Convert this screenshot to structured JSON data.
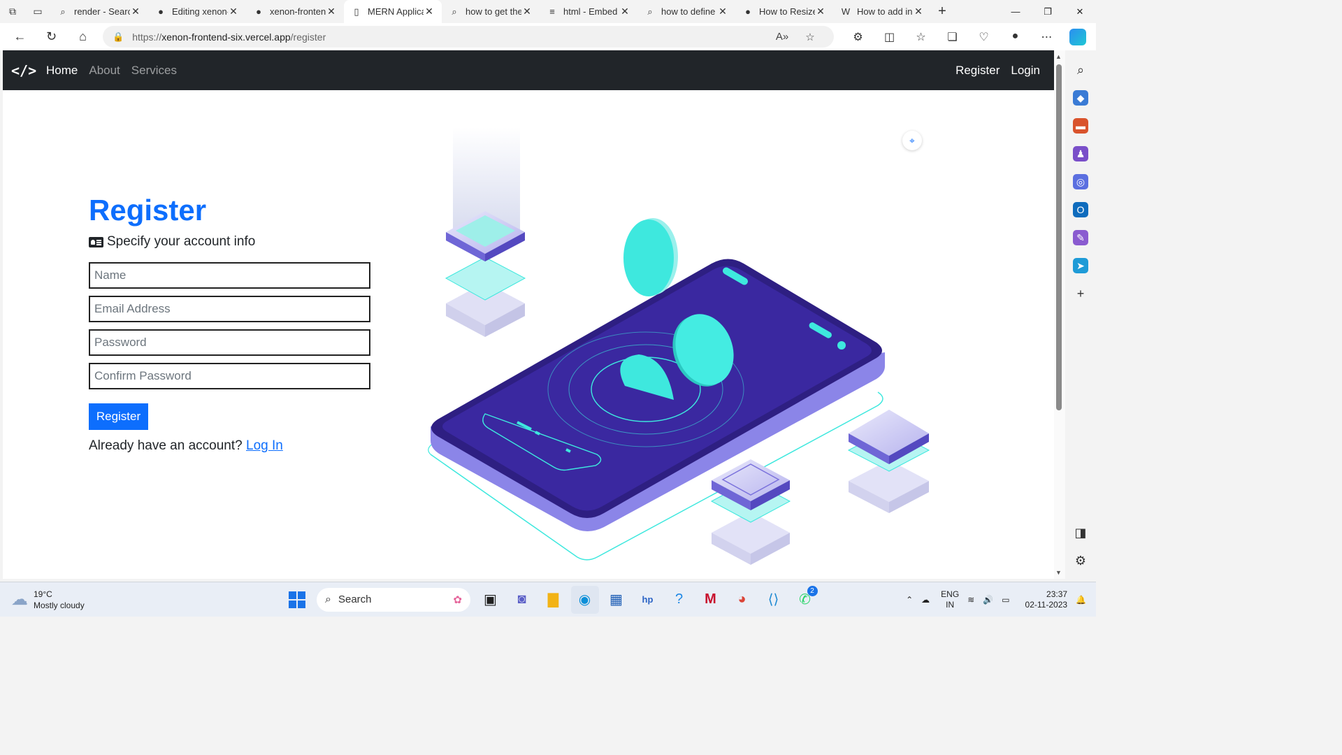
{
  "browser": {
    "tabs": [
      {
        "label": "render - Search",
        "icon": "search-icon",
        "active": false
      },
      {
        "label": "Editing xenon-frontend",
        "icon": "github-icon",
        "active": false
      },
      {
        "label": "xenon-frontend",
        "icon": "github-icon",
        "active": false
      },
      {
        "label": "MERN Application",
        "icon": "page-icon",
        "active": true
      },
      {
        "label": "how to get the",
        "icon": "search-icon",
        "active": false
      },
      {
        "label": "html - Embed",
        "icon": "stackoverflow-icon",
        "active": false
      },
      {
        "label": "how to define",
        "icon": "search-icon",
        "active": false
      },
      {
        "label": "How to Resize",
        "icon": "github-icon",
        "active": false
      },
      {
        "label": "How to add in",
        "icon": "wikipedia-icon",
        "active": false
      }
    ],
    "url_prefix": "https://",
    "url_host": "xenon-frontend-six.vercel.app",
    "url_path": "/register"
  },
  "navbar": {
    "brand": "</>",
    "links": [
      "Home",
      "About",
      "Services"
    ],
    "right_links": [
      "Register",
      "Login"
    ]
  },
  "form": {
    "title": "Register",
    "subtitle": "Specify your account info",
    "name_placeholder": "Name",
    "email_placeholder": "Email Address",
    "password_placeholder": "Password",
    "confirm_placeholder": "Confirm Password",
    "submit_label": "Register",
    "already_text": "Already have an account?",
    "login_link": "Log In"
  },
  "colors": {
    "primary": "#0d6efd",
    "navbar_bg": "#212529",
    "phone_body": "#2e1f82",
    "phone_side": "#8b85e8",
    "accent_teal": "#3ee8de"
  },
  "taskbar": {
    "temperature": "19°C",
    "weather": "Mostly cloudy",
    "search": "Search",
    "teams_badge": "2",
    "lang_top": "ENG",
    "lang_bottom": "IN",
    "time": "23:37",
    "date": "02-11-2023"
  }
}
